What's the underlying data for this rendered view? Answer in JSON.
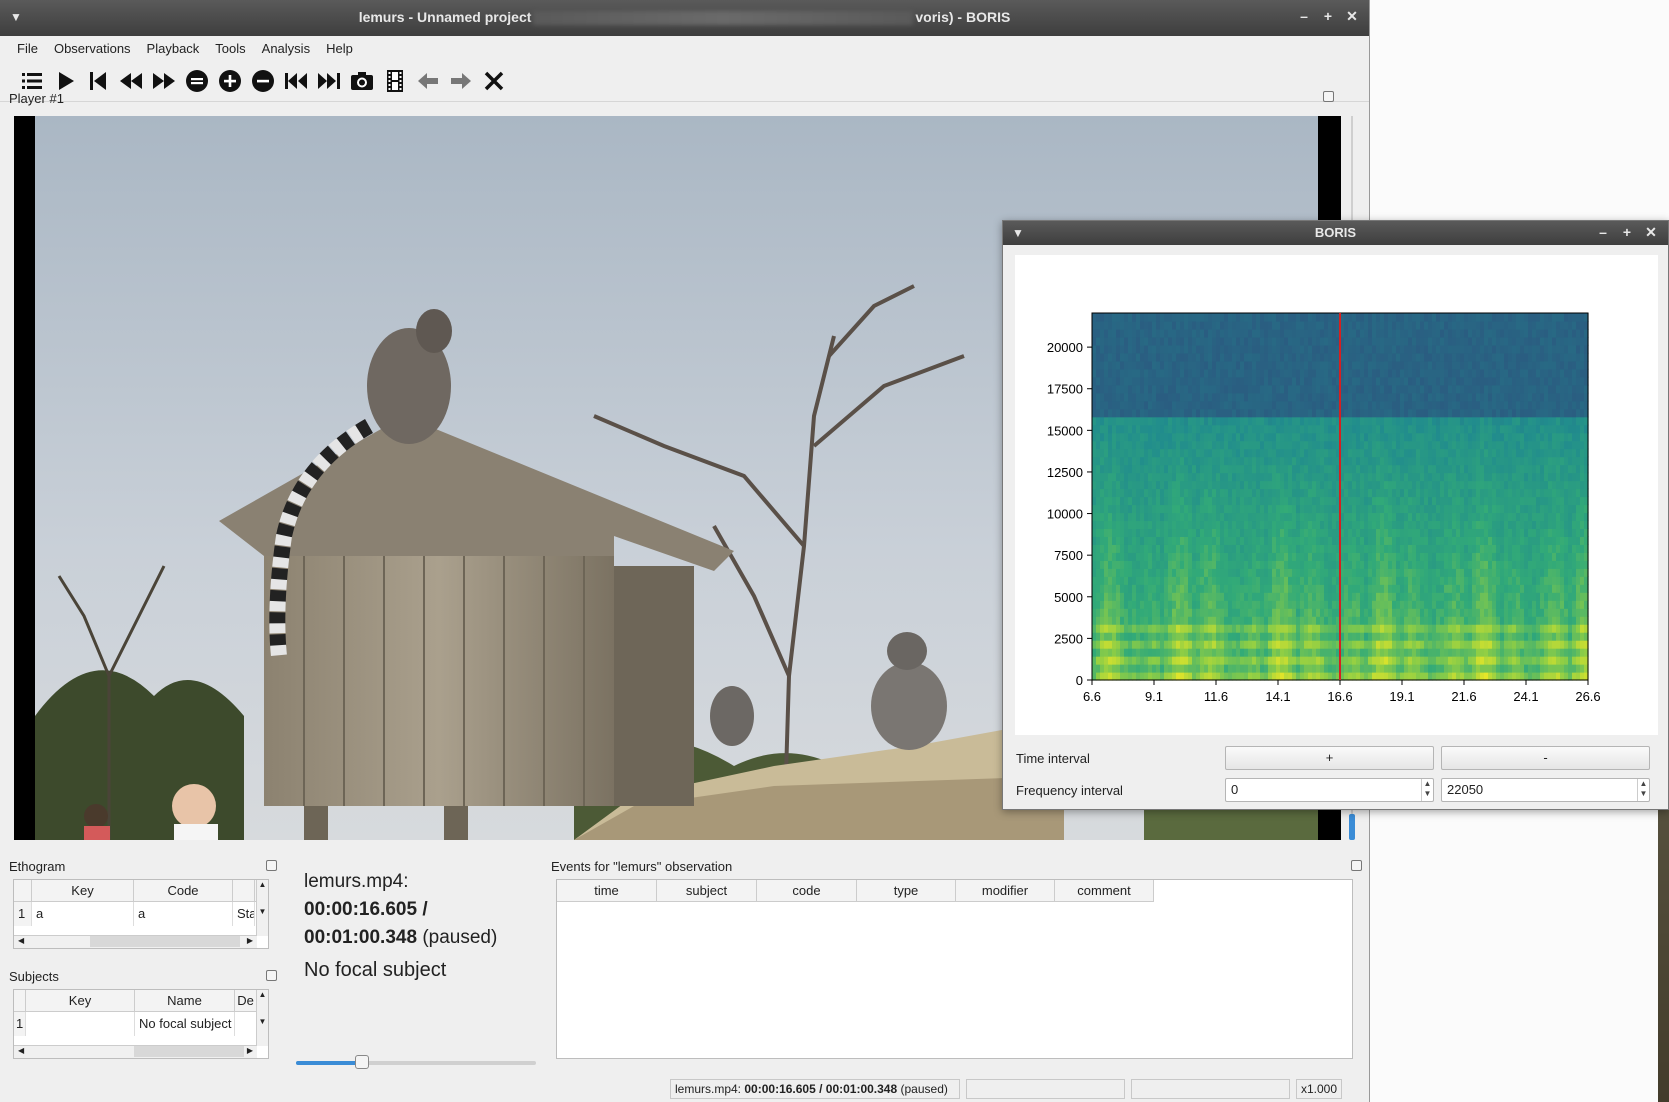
{
  "main_window": {
    "title": "lemurs - Unnamed project",
    "title_suffix": "voris) - BORIS"
  },
  "menu": [
    "File",
    "Observations",
    "Playback",
    "Tools",
    "Analysis",
    "Help"
  ],
  "toolbar_icons": [
    "list-icon",
    "play-icon",
    "jump-start-icon",
    "rewind-icon",
    "fast-forward-icon",
    "speed-reset-icon",
    "speed-up-icon",
    "speed-down-icon",
    "previous-media-icon",
    "next-media-icon",
    "snapshot-icon",
    "frame-by-frame-icon",
    "back-arrow-icon",
    "forward-arrow-icon",
    "close-observation-icon"
  ],
  "player": {
    "label": "Player #1"
  },
  "ethogram": {
    "title": "Ethogram",
    "headers": [
      "Key",
      "Code"
    ],
    "rows": [
      {
        "num": "1",
        "key": "a",
        "code": "a",
        "extra": "Stat"
      }
    ]
  },
  "subjects": {
    "title": "Subjects",
    "headers": [
      "Key",
      "Name",
      "De"
    ],
    "rows": [
      {
        "num": "1",
        "key": "",
        "name": "No focal subject"
      }
    ]
  },
  "media_info": {
    "filename": "lemurs.mp4:",
    "current_time": "00:00:16.605 /",
    "duration": "00:01:00.348",
    "state": "(paused)",
    "focal": "No focal subject",
    "position_fraction": 0.275
  },
  "events": {
    "title": "Events for \"lemurs\" observation",
    "columns": [
      "time",
      "subject",
      "code",
      "type",
      "modifier",
      "comment"
    ]
  },
  "status_bar": {
    "file": "lemurs.mp4:",
    "time": "00:00:16.605 / 00:01:00.348",
    "state": "(paused)",
    "speed": "x1.000"
  },
  "spectrogram_window": {
    "title": "BORIS",
    "time_interval_label": "Time interval",
    "plus_label": "+",
    "minus_label": "-",
    "frequency_interval_label": "Frequency interval",
    "freq_min": "0",
    "freq_max": "22050"
  },
  "chart_data": {
    "type": "heatmap",
    "x_ticks": [
      "6.6",
      "9.1",
      "11.6",
      "14.1",
      "16.6",
      "19.1",
      "21.6",
      "24.1",
      "26.6"
    ],
    "y_ticks": [
      "0",
      "2500",
      "5000",
      "7500",
      "10000",
      "12500",
      "15000",
      "17500",
      "20000"
    ],
    "xlim": [
      6.6,
      26.6
    ],
    "ylim": [
      0,
      22050
    ],
    "cursor_time": 16.6,
    "cursor_color": "#d62020",
    "cutoff_frequency": 15500,
    "colormap": "viridis"
  }
}
